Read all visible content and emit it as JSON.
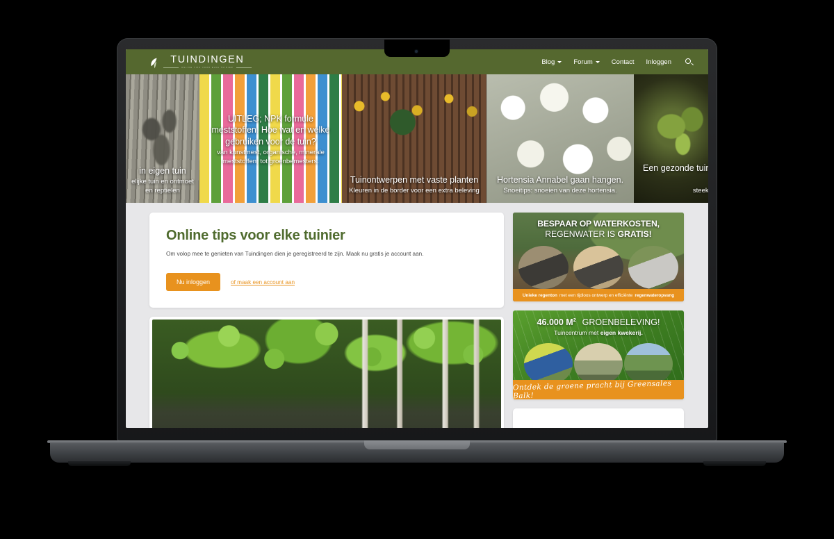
{
  "brand": {
    "name": "TUINDINGEN",
    "tagline": "ONLINE TIPS VOOR ELKE TUINIER",
    "logo_icon": "leaf-icon"
  },
  "nav": {
    "items": [
      {
        "label": "Blog",
        "has_dropdown": true
      },
      {
        "label": "Forum",
        "has_dropdown": true
      },
      {
        "label": "Contact",
        "has_dropdown": false
      },
      {
        "label": "Inloggen",
        "has_dropdown": false
      }
    ],
    "search_icon": "search-icon"
  },
  "hero": {
    "slides": [
      {
        "title": "in eigen tuin",
        "subtitle": "elijke tuin en ontmoet en reptielen",
        "image": "snake-on-wooden-deck"
      },
      {
        "title": "UITLEG; NPK formule meststoffen. Hoe wat en welke gebruiken voor de tuin?",
        "subtitle": "van kunstmest, organische, minerale meststoffen, tot groenbemesters.",
        "image": "fertilizer-products-shelf"
      },
      {
        "title": "Tuinontwerpen met vaste planten",
        "subtitle": "Kleuren in de border voor een extra beleving",
        "image": "garden-fence-with-sunflowers"
      },
      {
        "title": "Hortensia Annabel gaan hangen.",
        "subtitle": "Snoeitips: snoeien van deze hortensia.",
        "image": "white-hydrangea-annabelle"
      },
      {
        "title": "Een gezonde tuin met de el",
        "subtitle": "steek de kop ee",
        "image": "seedling-dark-soil"
      }
    ]
  },
  "login_card": {
    "title": "Online tips voor elke tuinier",
    "description": "Om volop mee te genieten van Tuindingen dien je geregistreerd te zijn. Maak nu gratis je account aan.",
    "button_label": "Nu inloggen",
    "register_link": "of maak een account aan"
  },
  "photo_card": {
    "image": "birch-trees-by-lake"
  },
  "ads": [
    {
      "id": "ad-water",
      "headline_line1": "BESPAAR OP WATERKOSTEN,",
      "headline_line2_light": "REGENWATER IS ",
      "headline_line2_bold": "GRATIS!",
      "strip_bold_start": "Unieke regenton",
      "strip_middle": " met een tijdloos ontwerp en efficiënte ",
      "strip_bold_end": "regenwateropvang",
      "image": "rain-barrels-collage"
    },
    {
      "id": "ad-green",
      "headline_number": "46.000 M",
      "headline_sup": "2",
      "headline_rest": "GROENBELEVING!",
      "subline_light": "Tuincentrum met ",
      "subline_bold": "eigen kwekerij.",
      "strip_script": "Ontdek de groene pracht bij Greensales Balk!",
      "image": "garden-centre-collage"
    }
  ],
  "colors": {
    "header_green": "#55682f",
    "heading_green": "#4f6b2e",
    "accent_orange": "#e8921e",
    "page_background": "#e7e7e9",
    "card_white": "#ffffff"
  }
}
